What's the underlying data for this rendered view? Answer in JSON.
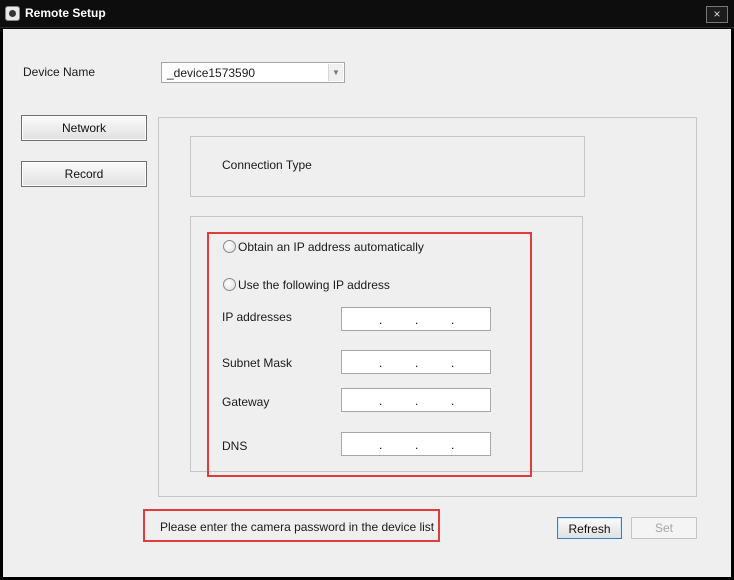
{
  "window": {
    "title": "Remote Setup",
    "close_glyph": "×"
  },
  "device": {
    "label": "Device Name",
    "selected": "_device1573590"
  },
  "nav": {
    "network_label": "Network",
    "record_label": "Record"
  },
  "connection": {
    "label": "Connection Type"
  },
  "ip_config": {
    "auto_label": "Obtain an IP address automatically",
    "manual_label": "Use the following IP address",
    "fields": [
      {
        "label": "IP addresses",
        "dots": "."
      },
      {
        "label": "Subnet Mask",
        "dots": "."
      },
      {
        "label": "Gateway",
        "dots": "."
      },
      {
        "label": "DNS",
        "dots": "."
      }
    ]
  },
  "status": {
    "message": "Please enter the camera password in the device list"
  },
  "actions": {
    "refresh_label": "Refresh",
    "set_label": "Set"
  },
  "colors": {
    "highlight": "#e03c3c",
    "refresh_border": "#3c7fb1"
  }
}
